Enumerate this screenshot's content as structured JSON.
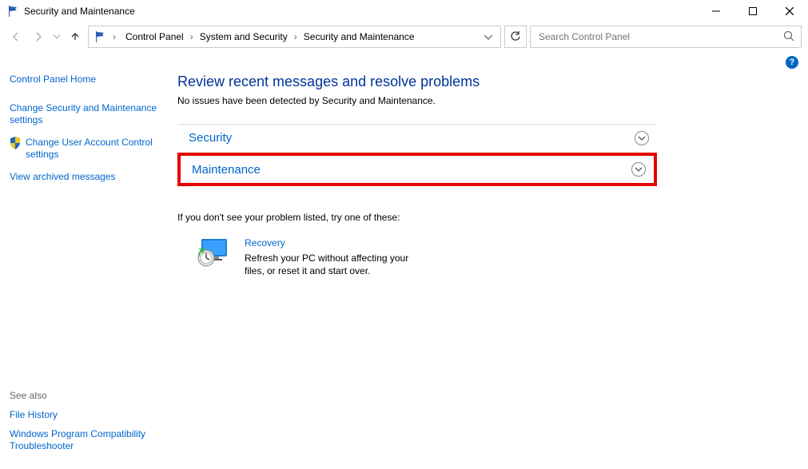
{
  "window": {
    "title": "Security and Maintenance"
  },
  "breadcrumb": {
    "items": [
      "Control Panel",
      "System and Security",
      "Security and Maintenance"
    ]
  },
  "search": {
    "placeholder": "Search Control Panel"
  },
  "sidebar": {
    "home": "Control Panel Home",
    "links": [
      "Change Security and Maintenance settings",
      "Change User Account Control settings",
      "View archived messages"
    ],
    "see_also_label": "See also",
    "see_also": [
      "File History",
      "Windows Program Compatibility Troubleshooter"
    ]
  },
  "main": {
    "heading": "Review recent messages and resolve problems",
    "status": "No issues have been detected by Security and Maintenance.",
    "sections": {
      "security": "Security",
      "maintenance": "Maintenance"
    },
    "prompt": "If you don't see your problem listed, try one of these:",
    "recovery": {
      "title": "Recovery",
      "desc": "Refresh your PC without affecting your files, or reset it and start over."
    }
  }
}
